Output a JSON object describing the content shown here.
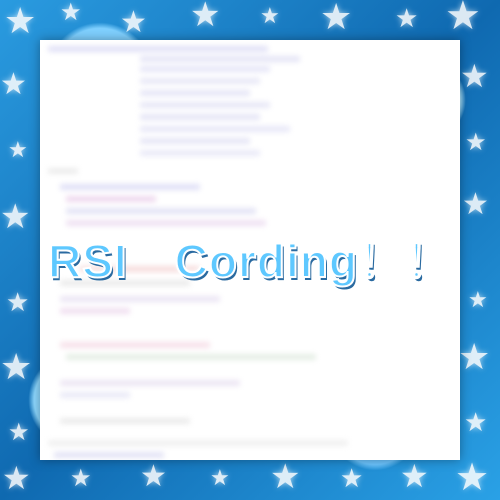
{
  "title": "RSI　Cording！！",
  "colors": {
    "frame_blue": "#1b7fc6",
    "title_fill": "#5ec8ff",
    "title_stroke": "#ffffff"
  }
}
